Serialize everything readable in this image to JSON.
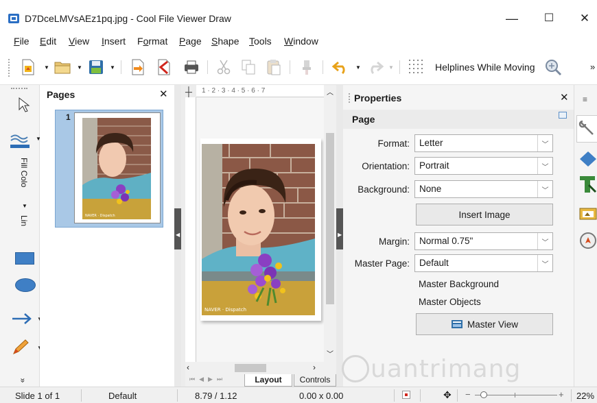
{
  "window": {
    "title": "D7DceLMVsAEz1pq.jpg - Cool File Viewer Draw",
    "minimize": "—",
    "maximize": "☐",
    "close": "✕"
  },
  "menu": [
    {
      "label": "File",
      "ul": "F",
      "rest": "ile"
    },
    {
      "label": "Edit",
      "ul": "E",
      "rest": "dit"
    },
    {
      "label": "View",
      "ul": "V",
      "rest": "iew"
    },
    {
      "label": "Insert",
      "ul": "I",
      "rest": "nsert"
    },
    {
      "label": "Format",
      "pre": "F",
      "ul": "o",
      "rest": "rmat"
    },
    {
      "label": "Page",
      "ul": "P",
      "rest": "age"
    },
    {
      "label": "Shape",
      "ul": "S",
      "rest": "hape"
    },
    {
      "label": "Tools",
      "ul": "T",
      "rest": "ools"
    },
    {
      "label": "Window",
      "ul": "W",
      "rest": "indow"
    }
  ],
  "toolbar": {
    "helplines_label": "Helplines While Moving",
    "more": "»"
  },
  "left_tools": {
    "fill_color_label": "Fill Colo",
    "line_label": "Lin",
    "expand": "»"
  },
  "pages_pane": {
    "title": "Pages",
    "close": "✕",
    "page_number": "1"
  },
  "ruler": {
    "ticks": "1  ·  2  ·  3  ·  4  ·  5  ·  6  ·  7"
  },
  "canvas_tabs": {
    "layout": "Layout",
    "controls": "Controls"
  },
  "properties": {
    "title": "Properties",
    "close": "✕",
    "section": "Page",
    "format_label": "Format:",
    "format_value": "Letter",
    "orientation_label": "Orientation:",
    "orientation_value": "Portrait",
    "background_label": "Background:",
    "background_value": "None",
    "insert_image": "Insert Image",
    "margin_label": "Margin:",
    "margin_value": "Normal 0.75\"",
    "master_page_label": "Master Page:",
    "master_page_value": "Default",
    "master_background": "Master Background",
    "master_objects": "Master Objects",
    "master_view": "Master View"
  },
  "status": {
    "slide": "Slide 1 of 1",
    "master": "Default",
    "position": "8.79 / 1.12",
    "size": "0.00 x 0.00",
    "zoom_minus": "−",
    "zoom_plus": "+",
    "zoom": "22%"
  },
  "watermark": "uantrimang",
  "photo_caption": "NAVER · Dispatch"
}
